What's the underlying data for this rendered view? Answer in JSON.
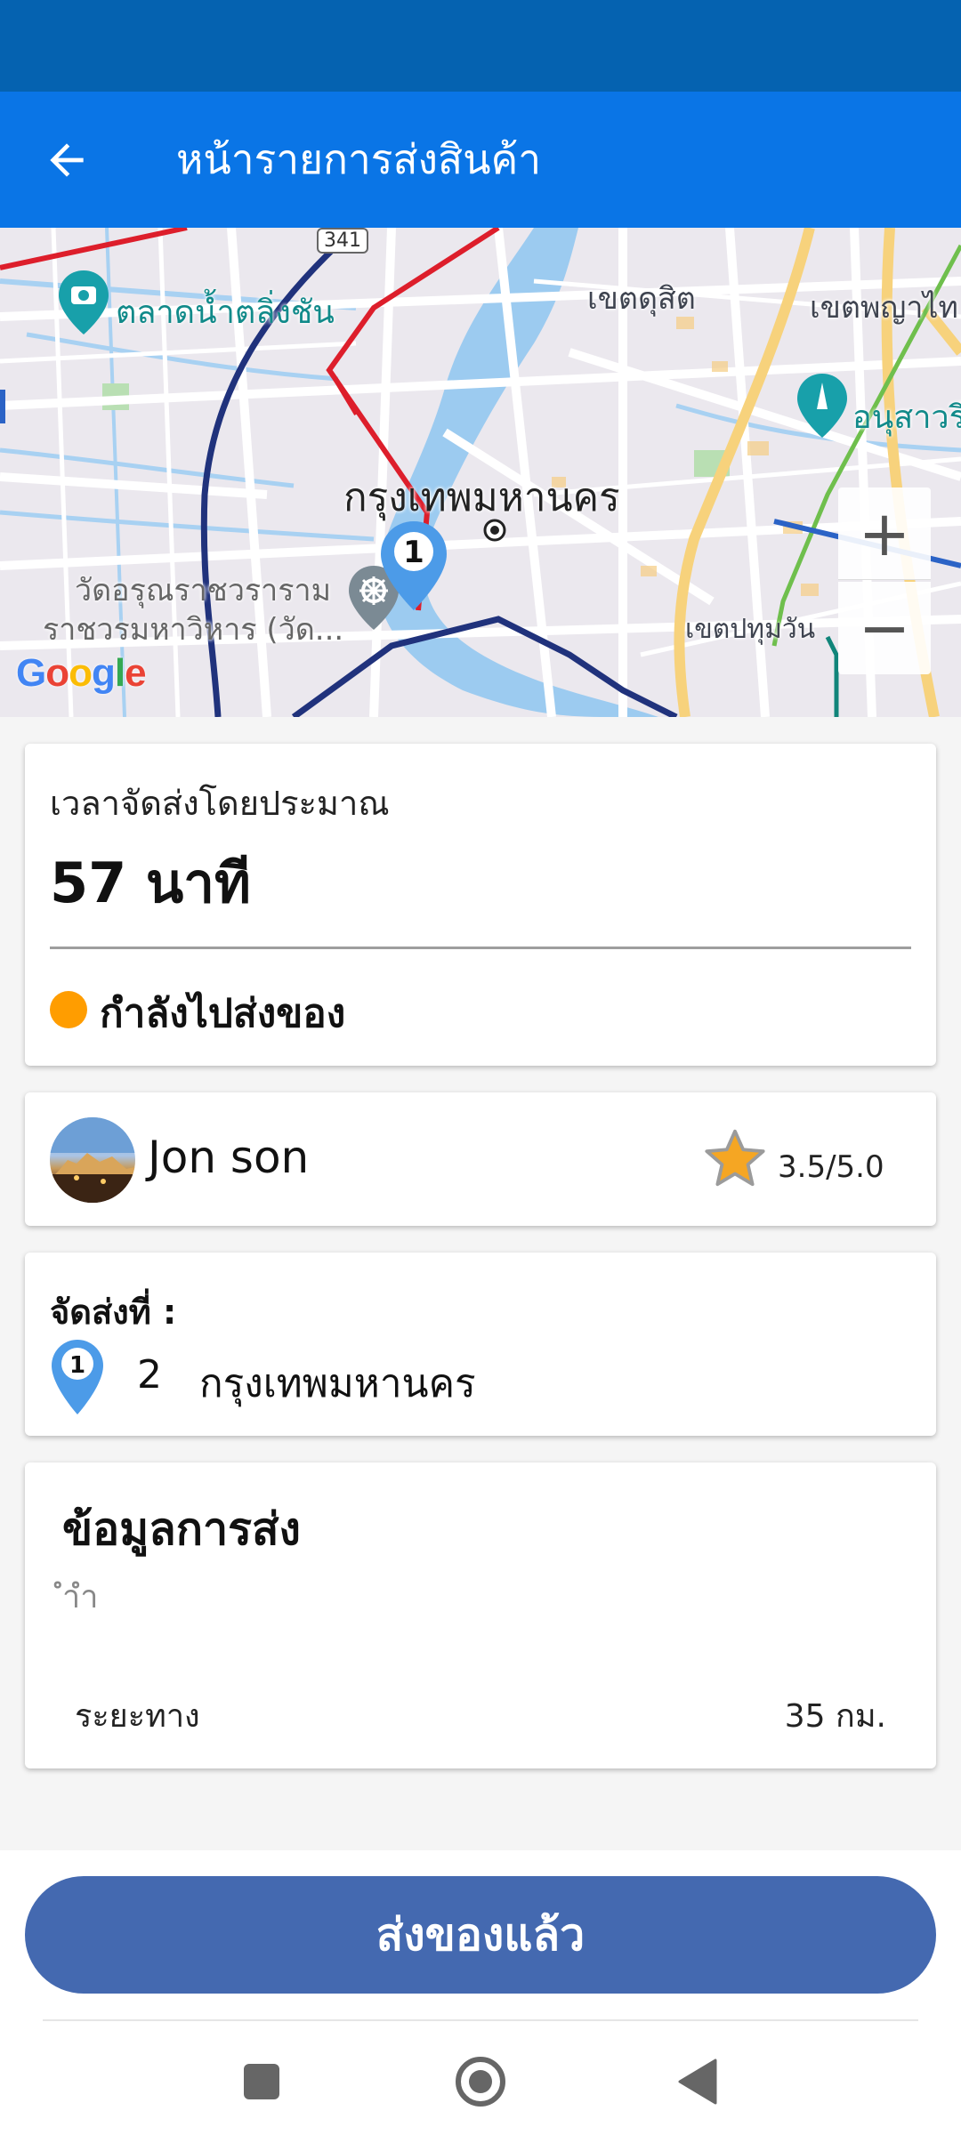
{
  "app_bar": {
    "title": "หน้ารายการส่งสินค้า",
    "back_icon": "arrow-left-icon"
  },
  "map": {
    "labels": {
      "market": "ตลาดน้ำตลิ่งชัน",
      "dusit": "เขตดุสิต",
      "phaya_thai": "เขตพญาไท",
      "victory": "อนุสาวรี",
      "bangkok": "กรุงเทพมหานคร",
      "temple_line1": "วัดอรุณราชวราราม",
      "temple_line2": "ราชวรมหาวิหาร (วัด...",
      "pathum_wan": "เขตปทุมวัน",
      "road_341": "341"
    },
    "marker_number": "1",
    "google_logo": [
      "G",
      "o",
      "o",
      "g",
      "l",
      "e"
    ],
    "zoom_in": "+",
    "zoom_out": "−"
  },
  "eta_card": {
    "label": "เวลาจัดส่งโดยประมาณ",
    "value": "57 นาที",
    "status": "กำลังไปส่งของ",
    "status_color": "#ff9d00"
  },
  "driver_card": {
    "name": "Jon son",
    "rating": "3.5/5.0"
  },
  "destination_card": {
    "label": "จัดส่งที่ :",
    "pin_number": "1",
    "number": "2",
    "city": "กรุงเทพมหานคร"
  },
  "info_card": {
    "title": "ข้อมูลการส่ง",
    "note": "ำำ",
    "distance_label": "ระยะทาง",
    "distance_value": "35 กม."
  },
  "action": {
    "deliver_label": "ส่งของแล้ว",
    "color": "#4469b0"
  },
  "colors": {
    "status_bar": "#0562b0",
    "app_bar": "#0a75e6"
  }
}
